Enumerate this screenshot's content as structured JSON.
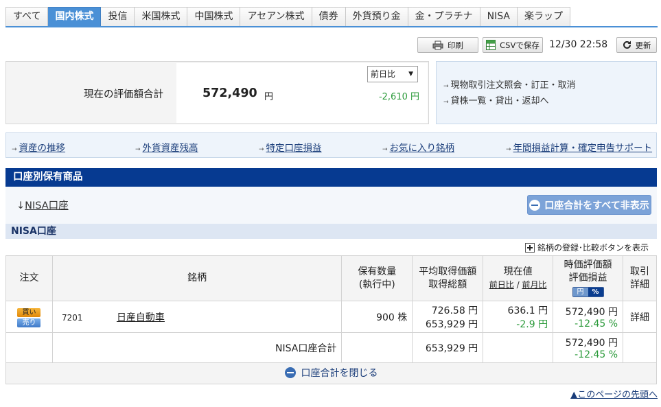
{
  "tabs": [
    "すべて",
    "国内株式",
    "投信",
    "米国株式",
    "中国株式",
    "アセアン株式",
    "債券",
    "外貨預り金",
    "金・プラチナ",
    "NISA",
    "楽ラップ"
  ],
  "active_tab": "国内株式",
  "toolbar": {
    "print_label": "印刷",
    "csv_label": "CSVで保存",
    "timestamp": "12/30 22:58",
    "refresh_label": "更新"
  },
  "summary": {
    "label": "現在の評価額合計",
    "amount": "572,490",
    "unit": "円",
    "compare_select": "前日比",
    "change": "-2,610 円"
  },
  "side_links": [
    "現物取引注文照会・訂正・取消",
    "貸株一覧・貸出・返却へ"
  ],
  "nav_links": [
    "資産の推移",
    "外貨資産残高",
    "特定口座損益",
    "お気に入り銘柄",
    "年間損益計算・確定申告サポート"
  ],
  "section_title": "口座別保有商品",
  "account_anchor": "NISA口座",
  "hide_all_label": "口座合計をすべて非表示",
  "nisa_title": "NISA口座",
  "show_compare_label": "銘柄の登録･比較ボタンを表示",
  "table": {
    "headers": {
      "order": "注文",
      "stock": "銘柄",
      "qty_1": "保有数量",
      "qty_2": "(執行中)",
      "avg_1": "平均取得価額",
      "avg_2": "取得総額",
      "cur_1": "現在値",
      "cur_sub_a": "前日比",
      "cur_sub_sep": " / ",
      "cur_sub_b": "前月比",
      "val_1": "時価評価額",
      "val_2": "評価損益",
      "toggle_yen": "円",
      "toggle_pct": "%",
      "detail_1": "取引",
      "detail_2": "詳細"
    },
    "row": {
      "buy": "買い",
      "sell": "売り",
      "code": "7201",
      "name": "日産自動車",
      "qty": "900 株",
      "avg_price": "726.58 円",
      "total_cost": "653,929 円",
      "current": "636.1 円",
      "day_change": "-2.9 円",
      "market_value": "572,490 円",
      "pl_pct": "-12.45 %",
      "detail": "詳細"
    },
    "total": {
      "label": "NISA口座合計",
      "total_cost": "653,929 円",
      "market_value": "572,490 円",
      "pl_pct": "-12.45 %"
    },
    "close_label": "口座合計を閉じる"
  },
  "page_top": "▲このページの先頭へ"
}
